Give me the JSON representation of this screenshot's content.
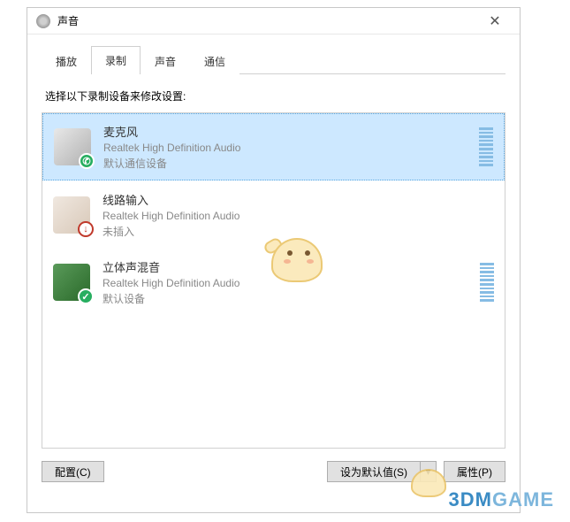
{
  "window": {
    "title": "声音"
  },
  "tabs": [
    {
      "id": "playback",
      "label": "播放",
      "active": false
    },
    {
      "id": "recording",
      "label": "录制",
      "active": true
    },
    {
      "id": "sound",
      "label": "声音",
      "active": false
    },
    {
      "id": "communication",
      "label": "通信",
      "active": false
    }
  ],
  "instruction": "选择以下录制设备来修改设置:",
  "devices": [
    {
      "id": "mic",
      "name": "麦克风",
      "desc": "Realtek High Definition Audio",
      "status": "默认通信设备",
      "iconKind": "mic",
      "badge": "phone-green",
      "selected": true,
      "meter": true
    },
    {
      "id": "line",
      "name": "线路输入",
      "desc": "Realtek High Definition Audio",
      "status": "未插入",
      "iconKind": "line",
      "badge": "down-red",
      "selected": false,
      "meter": false
    },
    {
      "id": "stereo",
      "name": "立体声混音",
      "desc": "Realtek High Definition Audio",
      "status": "默认设备",
      "iconKind": "sm",
      "badge": "check-green",
      "selected": false,
      "meter": true
    }
  ],
  "buttons": {
    "configure": "配置(C)",
    "setDefault": "设为默认值(S)",
    "properties": "属性(P)"
  },
  "watermark": {
    "part1": "3DM",
    "part2": "GAME"
  }
}
